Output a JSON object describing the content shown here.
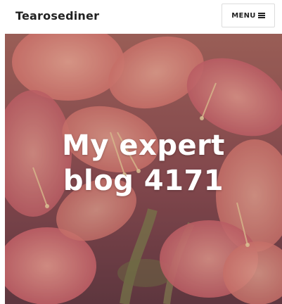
{
  "header": {
    "site_title": "Tearosediner",
    "menu_label": "MENU",
    "menu_icon": "hamburger-icon"
  },
  "hero": {
    "title_line1": "My expert",
    "title_line2": "blog 4171",
    "background_image": "coral-lily-flowers-photo"
  },
  "colors": {
    "text_dark": "#222222",
    "hero_text": "#ffffff",
    "flower_coral": "#e8897a",
    "flower_pink": "#d9707a",
    "leaf_green": "#8f9a5a"
  }
}
